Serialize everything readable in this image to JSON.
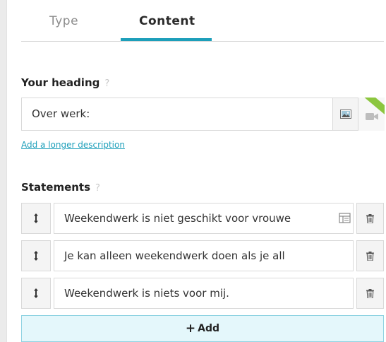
{
  "tabs": [
    {
      "label": "Type",
      "active": false
    },
    {
      "label": "Content",
      "active": true
    }
  ],
  "heading": {
    "label": "Your heading",
    "help": "?",
    "value": "Over werk:",
    "description_link": "Add a longer description"
  },
  "statements": {
    "label": "Statements",
    "help": "?",
    "items": [
      {
        "text": "Weekendwerk is niet geschikt voor vrouwe"
      },
      {
        "text": "Je kan alleen weekendwerk doen als je all"
      },
      {
        "text": "Weekendwerk is niets voor mij."
      }
    ],
    "add_label": "Add"
  },
  "colors": {
    "accent": "#1d9fba",
    "add_bg": "#e4f7fb",
    "ribbon": "#8cc63f"
  },
  "icons": {
    "image": "image-icon",
    "video": "video-camera-icon",
    "drag": "drag-handle-icon",
    "delete": "trash-icon",
    "add": "plus-icon"
  }
}
